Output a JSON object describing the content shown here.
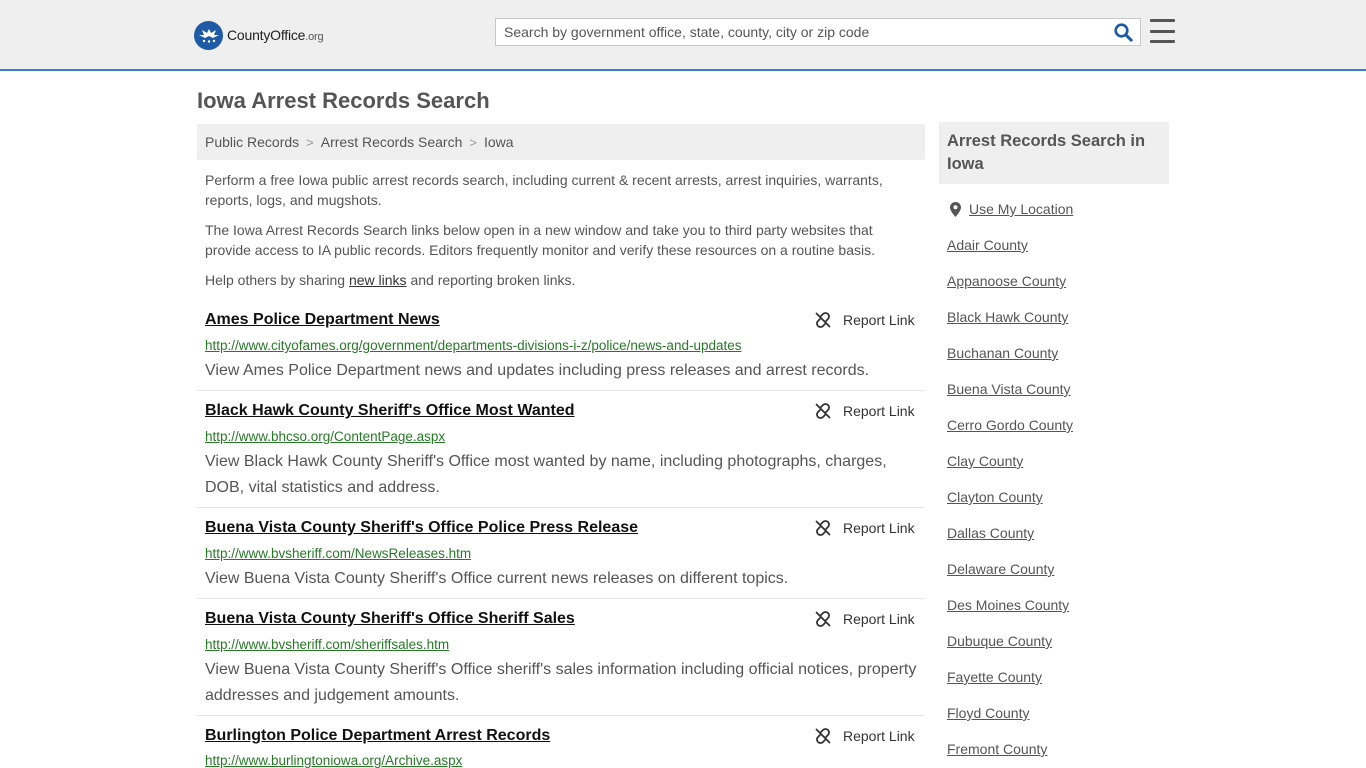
{
  "header": {
    "logo_brand": "CountyOffice",
    "logo_tld": ".org",
    "search_placeholder": "Search by government office, state, county, city or zip code"
  },
  "page": {
    "title": "Iowa Arrest Records Search"
  },
  "breadcrumb": [
    "Public Records",
    "Arrest Records Search",
    "Iowa"
  ],
  "intro": {
    "p1": "Perform a free Iowa public arrest records search, including current & recent arrests, arrest inquiries, warrants, reports, logs, and mugshots.",
    "p2": "The Iowa Arrest Records Search links below open in a new window and take you to third party websites that provide access to IA public records. Editors frequently monitor and verify these resources on a routine basis.",
    "p3_before": "Help others by sharing ",
    "p3_link": "new links",
    "p3_after": " and reporting broken links."
  },
  "report_label": "Report Link",
  "results": [
    {
      "title": "Ames Police Department News",
      "url": "http://www.cityofames.org/government/departments-divisions-i-z/police/news-and-updates",
      "desc": "View Ames Police Department news and updates including press releases and arrest records."
    },
    {
      "title": "Black Hawk County Sheriff's Office Most Wanted",
      "url": "http://www.bhcso.org/ContentPage.aspx",
      "desc": "View Black Hawk County Sheriff's Office most wanted by name, including photographs, charges, DOB, vital statistics and address."
    },
    {
      "title": "Buena Vista County Sheriff's Office Police Press Release",
      "url": "http://www.bvsheriff.com/NewsReleases.htm",
      "desc": "View Buena Vista County Sheriff's Office current news releases on different topics."
    },
    {
      "title": "Buena Vista County Sheriff's Office Sheriff Sales",
      "url": "http://www.bvsheriff.com/sheriffsales.htm",
      "desc": "View Buena Vista County Sheriff's Office sheriff's sales information including official notices, property addresses and judgement amounts."
    },
    {
      "title": "Burlington Police Department Arrest Records",
      "url": "http://www.burlingtoniowa.org/Archive.aspx",
      "desc": ""
    }
  ],
  "sidebar": {
    "title": "Arrest Records Search in Iowa",
    "use_location": "Use My Location",
    "counties": [
      "Adair County",
      "Appanoose County",
      "Black Hawk County",
      "Buchanan County",
      "Buena Vista County",
      "Cerro Gordo County",
      "Clay County",
      "Clayton County",
      "Dallas County",
      "Delaware County",
      "Des Moines County",
      "Dubuque County",
      "Fayette County",
      "Floyd County",
      "Fremont County"
    ]
  }
}
